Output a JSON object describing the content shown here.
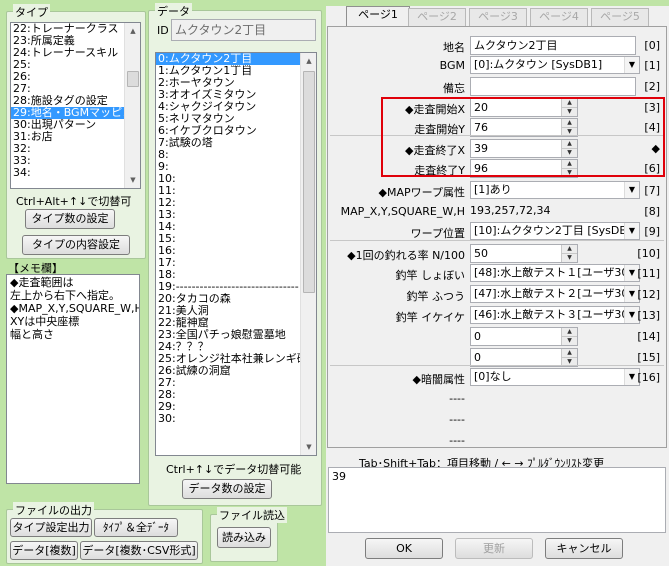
{
  "type_panel": {
    "title": "タイプ",
    "items": [
      "22:トレーナークラス",
      "23:所属定義",
      "24:トレーナースキル",
      "25:",
      "26:",
      "27:",
      "28:施設タグの設定",
      "29:地名・BGMマッピング",
      "30:出現パターン",
      "31:お店",
      "32:",
      "33:",
      "34:"
    ],
    "selected_index": 7,
    "hint": "Ctrl+Alt+↑↓で切替可",
    "count_button": "タイプ数の設定",
    "content_button": "タイプの内容設定"
  },
  "memo": {
    "title": "【メモ欄】",
    "lines": [
      "◆走査範囲は",
      "左上から右下へ指定。",
      "◆MAP_X,Y,SQUARE_W,H",
      "XYは中央座標",
      "幅と高さ"
    ]
  },
  "file_output": {
    "title": "ファイルの出力",
    "type_output": "タイプ設定出力",
    "type_all_data": "ﾀｲﾌﾟ＆全ﾃﾞｰﾀ",
    "data_copy": "データ[複数]",
    "data_csv": "データ[複数･CSV形式]"
  },
  "file_read": {
    "title": "ファイル読込",
    "load_button": "読み込み"
  },
  "data_panel": {
    "title": "データ",
    "id_label": "ID",
    "id_value": "ムクタウン2丁目",
    "items": [
      "0:ムクタウン2丁目",
      "1:ムクタウン1丁目",
      "2:ホーヤタウン",
      "3:オオイズミタウン",
      "4:シャクジイタウン",
      "5:ネリマタウン",
      "6:イケブクロタウン",
      "7:試験の塔",
      "8:",
      "9:",
      "10:",
      "11:",
      "12:",
      "13:",
      "14:",
      "15:",
      "16:",
      "17:",
      "18:",
      "19:-------------------------------",
      "20:タカコの森",
      "21:美人洞",
      "22:龍神窟",
      "23:全国パチっ娘慰霊墓地",
      "24:？？？",
      "25:オレンジ社本社兼レンギ研究",
      "26:試練の洞窟",
      "27:",
      "28:",
      "29:",
      "30:"
    ],
    "selected_index": 0,
    "hint": "Ctrl+↑↓でデータ切替可能",
    "count_button": "データ数の設定"
  },
  "tabs": [
    "ページ1",
    "ページ2",
    "ページ3",
    "ページ4",
    "ページ5"
  ],
  "active_tab": 0,
  "fields": {
    "place_name": {
      "label": "地名",
      "value": "ムクタウン2丁目",
      "index": "[0]"
    },
    "bgm": {
      "label": "BGM",
      "value": "[0]:ムクタウン [SysDB1]",
      "index": "[1]"
    },
    "note": {
      "label": "備忘",
      "value": "",
      "index": "[2]"
    },
    "scan_start_x": {
      "label": "◆走査開始X",
      "value": "20",
      "index": "[3]"
    },
    "scan_start_y": {
      "label": "走査開始Y",
      "value": "76",
      "index": "[4]"
    },
    "scan_end_x": {
      "label": "◆走査終了X",
      "value": "39",
      "index": "◆"
    },
    "scan_end_y": {
      "label": "走査終了Y",
      "value": "96",
      "index": "[6]"
    },
    "map_warp": {
      "label": "◆MAPワープ属性",
      "value": "[1]あり",
      "index": "[7]"
    },
    "map_xy": {
      "label": "MAP_X,Y,SQUARE_W,H",
      "value": "193,257,72,34",
      "index": "[8]"
    },
    "warp_pos": {
      "label": "ワープ位置",
      "value": "[10]:ムクタウン2丁目 [SysDB7]",
      "index": "[9]"
    },
    "fish_rate": {
      "label": "◆1回の釣れる率  N/100",
      "value": "50",
      "index": "[10]"
    },
    "rod_old": {
      "label": "釣竿  しょぼい",
      "value": "[48]:水上敵テスト１[ユーザ30]",
      "index": "[11]"
    },
    "rod_normal": {
      "label": "釣竿  ふつう",
      "value": "[47]:水上敵テスト２[ユーザ30]",
      "index": "[12]"
    },
    "rod_cool": {
      "label": "釣竿  イケイケ",
      "value": "[46]:水上敵テスト３[ユーザ30]",
      "index": "[13]"
    },
    "f14": {
      "label": "",
      "value": "0",
      "index": "[14]"
    },
    "f15": {
      "label": "",
      "value": "0",
      "index": "[15]"
    },
    "darkness": {
      "label": "◆暗闇属性",
      "value": "[0]なし",
      "index": "[16]"
    },
    "f17": {
      "label": "----",
      "value": "",
      "index": ""
    },
    "f18": {
      "label": "----",
      "value": "",
      "index": ""
    },
    "f19": {
      "label": "----",
      "value": "",
      "index": ""
    }
  },
  "tab_hint": "Tab･Shift+Tab：項目移動 / ← → ﾌﾟﾙﾀﾞｳﾝﾘｽﾄ変更",
  "memo_value": "39",
  "buttons": {
    "ok": "OK",
    "update": "更新",
    "cancel": "キャンセル"
  },
  "colors": {
    "selection": "#3399ff",
    "highlight_box": "#e0000a",
    "background": "#bfe4a6"
  }
}
